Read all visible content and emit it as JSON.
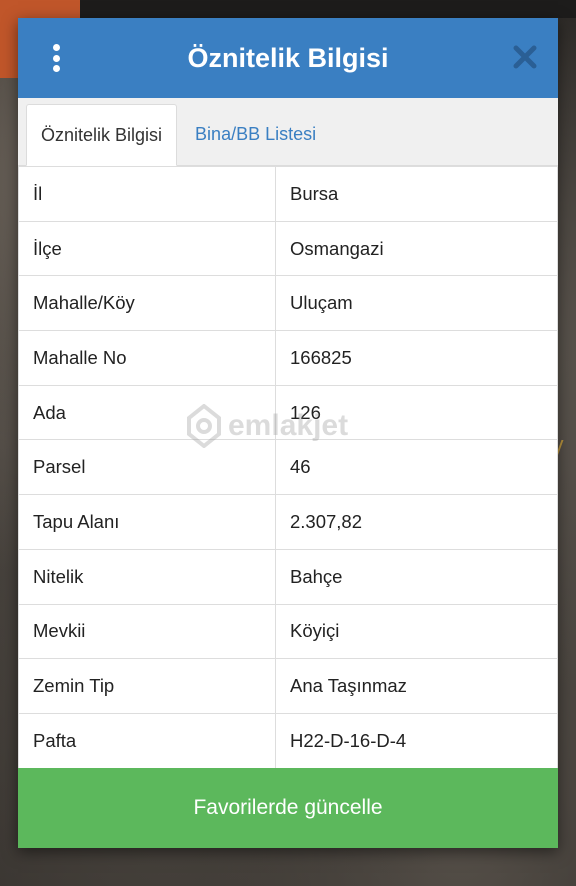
{
  "dialog": {
    "title": "Öznitelik Bilgisi"
  },
  "tabs": [
    {
      "label": "Öznitelik Bilgisi",
      "active": true
    },
    {
      "label": "Bina/BB Listesi",
      "active": false
    }
  ],
  "attributes": [
    {
      "key": "İl",
      "value": "Bursa"
    },
    {
      "key": "İlçe",
      "value": "Osmangazi"
    },
    {
      "key": "Mahalle/Köy",
      "value": "Uluçam"
    },
    {
      "key": "Mahalle No",
      "value": "166825"
    },
    {
      "key": "Ada",
      "value": "126"
    },
    {
      "key": "Parsel",
      "value": "46"
    },
    {
      "key": "Tapu Alanı",
      "value": "2.307,82"
    },
    {
      "key": "Nitelik",
      "value": "Bahçe"
    },
    {
      "key": "Mevkii",
      "value": "Köyiçi"
    },
    {
      "key": "Zemin Tip",
      "value": "Ana Taşınmaz"
    },
    {
      "key": "Pafta",
      "value": "H22-D-16-D-4"
    }
  ],
  "footer": {
    "button_label": "Favorilerde güncelle"
  },
  "watermark": {
    "text": "emlakjet"
  },
  "colors": {
    "header": "#3a7fc2",
    "tab_link": "#3a7fc2",
    "footer_button": "#5cb85c"
  },
  "icons": [
    "more-vertical-icon",
    "close-icon",
    "location-pin-icon"
  ]
}
